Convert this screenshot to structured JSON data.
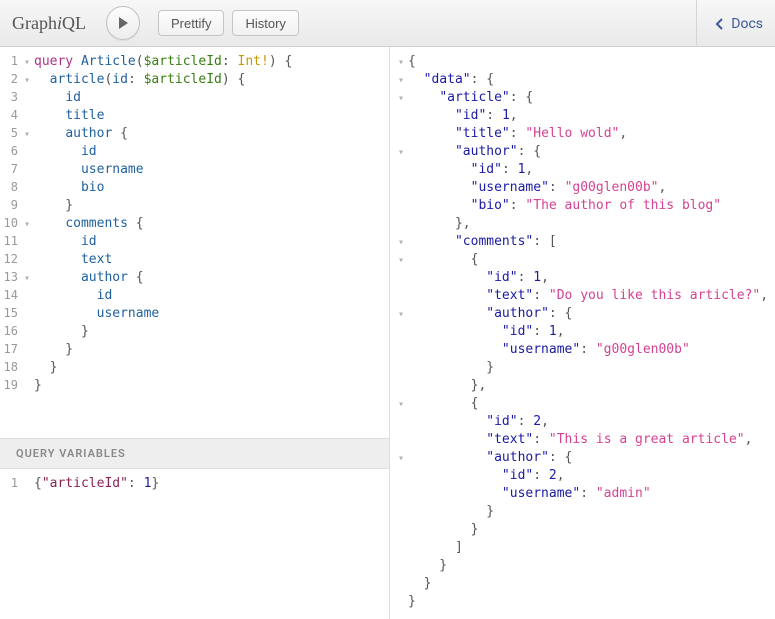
{
  "toolbar": {
    "logo_prefix": "Graph",
    "logo_em": "i",
    "logo_suffix": "QL",
    "prettify_label": "Prettify",
    "history_label": "History",
    "docs_label": "Docs"
  },
  "query": {
    "lines": [
      {
        "n": 1,
        "fold": "▾",
        "tokens": [
          [
            "kw",
            "query"
          ],
          [
            "punc",
            " "
          ],
          [
            "def",
            "Article"
          ],
          [
            "punc",
            "("
          ],
          [
            "var",
            "$articleId"
          ],
          [
            "punc",
            ": "
          ],
          [
            "type",
            "Int!"
          ],
          [
            "punc",
            ") {"
          ]
        ]
      },
      {
        "n": 2,
        "fold": "▾",
        "tokens": [
          [
            "punc",
            "  "
          ],
          [
            "field",
            "article"
          ],
          [
            "punc",
            "("
          ],
          [
            "attr",
            "id"
          ],
          [
            "punc",
            ": "
          ],
          [
            "var",
            "$articleId"
          ],
          [
            "punc",
            ") {"
          ]
        ]
      },
      {
        "n": 3,
        "fold": "",
        "tokens": [
          [
            "punc",
            "    "
          ],
          [
            "field",
            "id"
          ]
        ]
      },
      {
        "n": 4,
        "fold": "",
        "tokens": [
          [
            "punc",
            "    "
          ],
          [
            "field",
            "title"
          ]
        ]
      },
      {
        "n": 5,
        "fold": "▾",
        "tokens": [
          [
            "punc",
            "    "
          ],
          [
            "field",
            "author"
          ],
          [
            "punc",
            " {"
          ]
        ]
      },
      {
        "n": 6,
        "fold": "",
        "tokens": [
          [
            "punc",
            "      "
          ],
          [
            "field",
            "id"
          ]
        ]
      },
      {
        "n": 7,
        "fold": "",
        "tokens": [
          [
            "punc",
            "      "
          ],
          [
            "field",
            "username"
          ]
        ]
      },
      {
        "n": 8,
        "fold": "",
        "tokens": [
          [
            "punc",
            "      "
          ],
          [
            "field",
            "bio"
          ]
        ]
      },
      {
        "n": 9,
        "fold": "",
        "tokens": [
          [
            "punc",
            "    }"
          ]
        ]
      },
      {
        "n": 10,
        "fold": "▾",
        "tokens": [
          [
            "punc",
            "    "
          ],
          [
            "field",
            "comments"
          ],
          [
            "punc",
            " {"
          ]
        ]
      },
      {
        "n": 11,
        "fold": "",
        "tokens": [
          [
            "punc",
            "      "
          ],
          [
            "field",
            "id"
          ]
        ]
      },
      {
        "n": 12,
        "fold": "",
        "tokens": [
          [
            "punc",
            "      "
          ],
          [
            "field",
            "text"
          ]
        ]
      },
      {
        "n": 13,
        "fold": "▾",
        "tokens": [
          [
            "punc",
            "      "
          ],
          [
            "field",
            "author"
          ],
          [
            "punc",
            " {"
          ]
        ]
      },
      {
        "n": 14,
        "fold": "",
        "tokens": [
          [
            "punc",
            "        "
          ],
          [
            "field",
            "id"
          ]
        ]
      },
      {
        "n": 15,
        "fold": "",
        "tokens": [
          [
            "punc",
            "        "
          ],
          [
            "field",
            "username"
          ]
        ]
      },
      {
        "n": 16,
        "fold": "",
        "tokens": [
          [
            "punc",
            "      }"
          ]
        ]
      },
      {
        "n": 17,
        "fold": "",
        "tokens": [
          [
            "punc",
            "    }"
          ]
        ]
      },
      {
        "n": 18,
        "fold": "",
        "tokens": [
          [
            "punc",
            "  }"
          ]
        ]
      },
      {
        "n": 19,
        "fold": "",
        "tokens": [
          [
            "punc",
            "}"
          ]
        ]
      }
    ]
  },
  "vars_header": "QUERY VARIABLES",
  "variables": {
    "lines": [
      {
        "n": 1,
        "tokens": [
          [
            "jpunc",
            "{"
          ],
          [
            "jkey",
            "\"articleId\""
          ],
          [
            "jpunc",
            ": "
          ],
          [
            "jnum",
            "1"
          ],
          [
            "jpunc",
            "}"
          ]
        ]
      }
    ]
  },
  "result": {
    "lines": [
      {
        "fold": "▾",
        "tokens": [
          [
            "rpunc",
            "{"
          ]
        ]
      },
      {
        "fold": "▾",
        "tokens": [
          [
            "rpunc",
            "  "
          ],
          [
            "rkey",
            "\"data\""
          ],
          [
            "rpunc",
            ": {"
          ]
        ]
      },
      {
        "fold": "▾",
        "tokens": [
          [
            "rpunc",
            "    "
          ],
          [
            "rkey",
            "\"article\""
          ],
          [
            "rpunc",
            ": {"
          ]
        ]
      },
      {
        "fold": "",
        "tokens": [
          [
            "rpunc",
            "      "
          ],
          [
            "rkey",
            "\"id\""
          ],
          [
            "rpunc",
            ": "
          ],
          [
            "rnum",
            "1"
          ],
          [
            "rpunc",
            ","
          ]
        ]
      },
      {
        "fold": "",
        "tokens": [
          [
            "rpunc",
            "      "
          ],
          [
            "rkey",
            "\"title\""
          ],
          [
            "rpunc",
            ": "
          ],
          [
            "rstr",
            "\"Hello wold\""
          ],
          [
            "rpunc",
            ","
          ]
        ]
      },
      {
        "fold": "▾",
        "tokens": [
          [
            "rpunc",
            "      "
          ],
          [
            "rkey",
            "\"author\""
          ],
          [
            "rpunc",
            ": {"
          ]
        ]
      },
      {
        "fold": "",
        "tokens": [
          [
            "rpunc",
            "        "
          ],
          [
            "rkey",
            "\"id\""
          ],
          [
            "rpunc",
            ": "
          ],
          [
            "rnum",
            "1"
          ],
          [
            "rpunc",
            ","
          ]
        ]
      },
      {
        "fold": "",
        "tokens": [
          [
            "rpunc",
            "        "
          ],
          [
            "rkey",
            "\"username\""
          ],
          [
            "rpunc",
            ": "
          ],
          [
            "rstr",
            "\"g00glen00b\""
          ],
          [
            "rpunc",
            ","
          ]
        ]
      },
      {
        "fold": "",
        "tokens": [
          [
            "rpunc",
            "        "
          ],
          [
            "rkey",
            "\"bio\""
          ],
          [
            "rpunc",
            ": "
          ],
          [
            "rstr",
            "\"The author of this blog\""
          ]
        ]
      },
      {
        "fold": "",
        "tokens": [
          [
            "rpunc",
            "      },"
          ]
        ]
      },
      {
        "fold": "▾",
        "tokens": [
          [
            "rpunc",
            "      "
          ],
          [
            "rkey",
            "\"comments\""
          ],
          [
            "rpunc",
            ": ["
          ]
        ]
      },
      {
        "fold": "▾",
        "tokens": [
          [
            "rpunc",
            "        {"
          ]
        ]
      },
      {
        "fold": "",
        "tokens": [
          [
            "rpunc",
            "          "
          ],
          [
            "rkey",
            "\"id\""
          ],
          [
            "rpunc",
            ": "
          ],
          [
            "rnum",
            "1"
          ],
          [
            "rpunc",
            ","
          ]
        ]
      },
      {
        "fold": "",
        "tokens": [
          [
            "rpunc",
            "          "
          ],
          [
            "rkey",
            "\"text\""
          ],
          [
            "rpunc",
            ": "
          ],
          [
            "rstr",
            "\"Do you like this article?\""
          ],
          [
            "rpunc",
            ","
          ]
        ]
      },
      {
        "fold": "▾",
        "tokens": [
          [
            "rpunc",
            "          "
          ],
          [
            "rkey",
            "\"author\""
          ],
          [
            "rpunc",
            ": {"
          ]
        ]
      },
      {
        "fold": "",
        "tokens": [
          [
            "rpunc",
            "            "
          ],
          [
            "rkey",
            "\"id\""
          ],
          [
            "rpunc",
            ": "
          ],
          [
            "rnum",
            "1"
          ],
          [
            "rpunc",
            ","
          ]
        ]
      },
      {
        "fold": "",
        "tokens": [
          [
            "rpunc",
            "            "
          ],
          [
            "rkey",
            "\"username\""
          ],
          [
            "rpunc",
            ": "
          ],
          [
            "rstr",
            "\"g00glen00b\""
          ]
        ]
      },
      {
        "fold": "",
        "tokens": [
          [
            "rpunc",
            "          }"
          ]
        ]
      },
      {
        "fold": "",
        "tokens": [
          [
            "rpunc",
            "        },"
          ]
        ]
      },
      {
        "fold": "▾",
        "tokens": [
          [
            "rpunc",
            "        {"
          ]
        ]
      },
      {
        "fold": "",
        "tokens": [
          [
            "rpunc",
            "          "
          ],
          [
            "rkey",
            "\"id\""
          ],
          [
            "rpunc",
            ": "
          ],
          [
            "rnum",
            "2"
          ],
          [
            "rpunc",
            ","
          ]
        ]
      },
      {
        "fold": "",
        "tokens": [
          [
            "rpunc",
            "          "
          ],
          [
            "rkey",
            "\"text\""
          ],
          [
            "rpunc",
            ": "
          ],
          [
            "rstr",
            "\"This is a great article\""
          ],
          [
            "rpunc",
            ","
          ]
        ]
      },
      {
        "fold": "▾",
        "tokens": [
          [
            "rpunc",
            "          "
          ],
          [
            "rkey",
            "\"author\""
          ],
          [
            "rpunc",
            ": {"
          ]
        ]
      },
      {
        "fold": "",
        "tokens": [
          [
            "rpunc",
            "            "
          ],
          [
            "rkey",
            "\"id\""
          ],
          [
            "rpunc",
            ": "
          ],
          [
            "rnum",
            "2"
          ],
          [
            "rpunc",
            ","
          ]
        ]
      },
      {
        "fold": "",
        "tokens": [
          [
            "rpunc",
            "            "
          ],
          [
            "rkey",
            "\"username\""
          ],
          [
            "rpunc",
            ": "
          ],
          [
            "rstr",
            "\"admin\""
          ]
        ]
      },
      {
        "fold": "",
        "tokens": [
          [
            "rpunc",
            "          }"
          ]
        ]
      },
      {
        "fold": "",
        "tokens": [
          [
            "rpunc",
            "        }"
          ]
        ]
      },
      {
        "fold": "",
        "tokens": [
          [
            "rpunc",
            "      ]"
          ]
        ]
      },
      {
        "fold": "",
        "tokens": [
          [
            "rpunc",
            "    }"
          ]
        ]
      },
      {
        "fold": "",
        "tokens": [
          [
            "rpunc",
            "  }"
          ]
        ]
      },
      {
        "fold": "",
        "tokens": [
          [
            "rpunc",
            "}"
          ]
        ]
      }
    ]
  }
}
